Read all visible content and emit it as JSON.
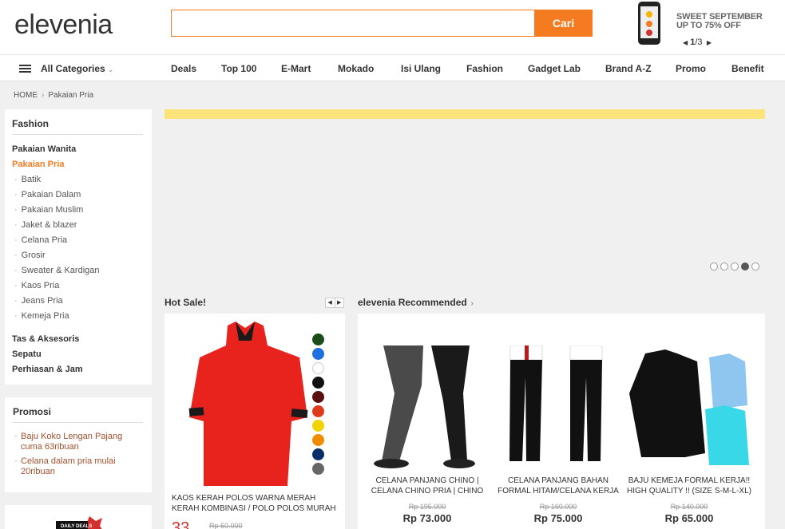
{
  "header": {
    "logo": "elevenia",
    "search": {
      "placeholder": "",
      "value": "",
      "button": "Cari"
    },
    "promo": {
      "line1": "SWEET SEPTEMBER",
      "line2": "UP TO 75% OFF",
      "pager_current": "1",
      "pager_total": "/3"
    }
  },
  "nav": {
    "all_categories": "All Categories",
    "items": [
      "Deals",
      "Top 100",
      "E-Mart",
      "Mokado",
      "Isi Ulang",
      "Fashion",
      "Gadget Lab",
      "Brand A-Z",
      "Promo",
      "Benefit"
    ]
  },
  "breadcrumb": [
    "HOME",
    "Pakaian Pria"
  ],
  "sidebar": {
    "title": "Fashion",
    "categories": [
      {
        "label": "Pakaian Wanita",
        "active": false
      },
      {
        "label": "Pakaian Pria",
        "active": true
      }
    ],
    "subcategories": [
      "Batik",
      "Pakaian Dalam",
      "Pakaian Muslim",
      "Jaket & blazer",
      "Celana Pria",
      "Grosir",
      "Sweater & Kardigan",
      "Kaos Pria",
      "Jeans Pria",
      "Kemeja Pria"
    ],
    "other_categories": [
      "Tas & Aksesoris",
      "Sepatu",
      "Perhiasan & Jam"
    ]
  },
  "promosi": {
    "title": "Promosi",
    "links": [
      "Baju Koko Lengan Pajang cuma 63ribuan",
      "Celana dalam pria mulai 20ribuan"
    ]
  },
  "daily_deals": {
    "label": "DAILY DEALS"
  },
  "banner": {
    "slides": 5,
    "active_slide": 4
  },
  "hot_sale": {
    "title": "Hot Sale!",
    "product": {
      "name": "KAOS KERAH POLOS WARNA MERAH KERAH KOMBINASI / POLO POLOS MURAH",
      "price": "33",
      "old_price": "Rp 50.000",
      "swatches": [
        "#1b4d1b",
        "#1e6fe0",
        "#ffffff",
        "#111111",
        "#5a1010",
        "#e03a1e",
        "#f2d300",
        "#f08c00",
        "#0b2e6b",
        "#666666"
      ]
    }
  },
  "recommended": {
    "title": "elevenia Recommended",
    "products": [
      {
        "name": "CELANA PANJANG CHINO | CELANA CHINO PRIA | CHINO",
        "old_price": "Rp 195.000",
        "price": "Rp 73.000"
      },
      {
        "name": "CELANA PANJANG BAHAN FORMAL HITAM/CELANA KERJA",
        "old_price": "Rp 160.000",
        "price": "Rp 75.000"
      },
      {
        "name": "BAJU KEMEJA FORMAL KERJA!! HIGH QUALITY !! (SIZE S-M-L-XL)",
        "old_price": "Rp 140.000",
        "price": "Rp 65.000"
      }
    ]
  },
  "colors": {
    "accent": "#f47b20",
    "promo_link": "#a0522d",
    "price_red": "#d32f2f"
  }
}
